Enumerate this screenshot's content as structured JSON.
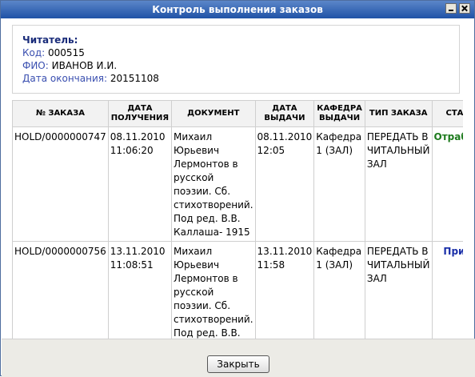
{
  "window": {
    "title": "Контроль выполнения заказов"
  },
  "reader": {
    "heading": "Читатель:",
    "code_label": "Код:",
    "code_value": "000515",
    "name_label": "ФИО:",
    "name_value": "ИВАНОВ И.И.",
    "end_label": "Дата окончания:",
    "end_value": "20151108"
  },
  "table": {
    "headers": [
      "№ ЗАКАЗА",
      "ДАТА ПОЛУЧЕНИЯ",
      "ДОКУМЕНТ",
      "ДАТА ВЫДАЧИ",
      "КАФЕДРА ВЫДАЧИ",
      "ТИП ЗАКАЗА",
      "СТАТУС"
    ],
    "rows": [
      {
        "order_no": "HOLD/0000000747",
        "received": "08.11.2010 11:06:20",
        "document": "Михаил Юрьевич Лермонтов в русской поэзии. Сб. стихотворений. Под ред. В.В. Каллаша- 1915",
        "issue_date": "08.11.2010 12:05",
        "desk": "Кафедра 1 (ЗАЛ)",
        "order_type": "ПЕРЕДАТЬ В ЧИТАЛЬНЫЙ ЗАЛ",
        "status": "Отработан"
      },
      {
        "order_no": "HOLD/0000000756",
        "received": "13.11.2010 11:08:51",
        "document": "Михаил Юрьевич Лермонтов в русской поэзии. Сб. стихотворений. Под ред. В.В. Каллаша- 1915",
        "issue_date": "13.11.2010 11:58",
        "desk": "Кафедра 1 (ЗАЛ)",
        "order_type": "ПЕРЕДАТЬ В ЧИТАЛЬНЫЙ ЗАЛ",
        "status": "Принят"
      }
    ]
  },
  "footer": {
    "close_label": "Закрыть"
  },
  "colors": {
    "status_done": "#1d7a1d",
    "status_accepted": "#1a2fa8",
    "titlebar": "#2a5aae"
  }
}
